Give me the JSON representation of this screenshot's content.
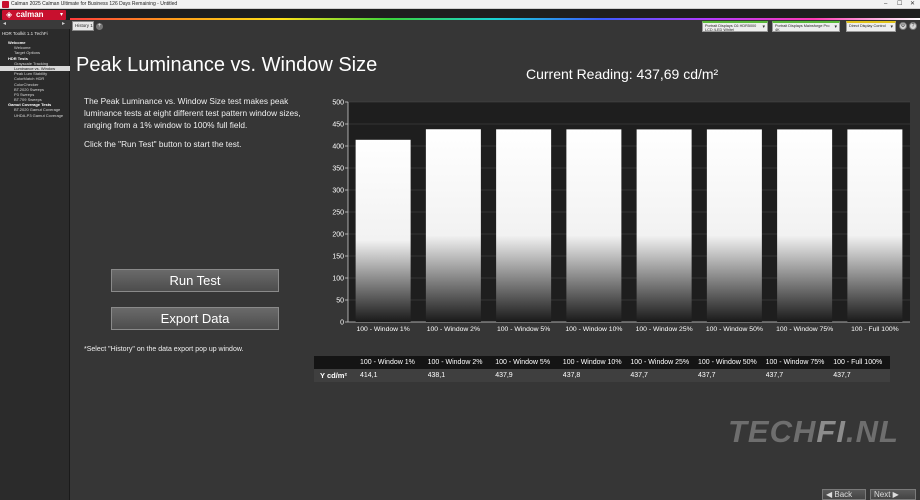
{
  "window": {
    "title": "Calman 2025 Calman Ultimate for Business 126 Days Remaining - Untitled",
    "controls": [
      "–",
      "☐",
      "✕"
    ]
  },
  "app": {
    "logo": "calman"
  },
  "sidebar": {
    "workspace": "HDR Toolkit 1.1 TechFi",
    "items": [
      {
        "label": "Welcome",
        "level": "h"
      },
      {
        "label": "Welcome",
        "level": "i"
      },
      {
        "label": "Target Options",
        "level": "i"
      },
      {
        "label": "HDR Tests",
        "level": "h"
      },
      {
        "label": "Grayscale Tracking",
        "level": "i"
      },
      {
        "label": "Luminance vs. Window",
        "level": "i",
        "selected": true
      },
      {
        "label": "Peak Lum Stability",
        "level": "i"
      },
      {
        "label": "ColorMatch HDR",
        "level": "i"
      },
      {
        "label": "ColorChecker",
        "level": "i"
      },
      {
        "label": "BT.2020 Sweeps",
        "level": "i"
      },
      {
        "label": "P3 Sweeps",
        "level": "i"
      },
      {
        "label": "BT.709 Sweeps",
        "level": "i"
      },
      {
        "label": "Gamut Coverage Tests",
        "level": "h"
      },
      {
        "label": "BT.2020 Gamut Coverage",
        "level": "i"
      },
      {
        "label": "UHDA-P3 Gamut Coverage",
        "level": "i"
      }
    ]
  },
  "tabs": [
    {
      "label": "History 1"
    }
  ],
  "toolbar": {
    "dropdown1": "Portrait Displays C6 HDR5000 LCD (LED White)",
    "dropdown2": "Portrait Displays Mainsforge Pro 4K",
    "dropdown3": "Direct Display Control"
  },
  "main": {
    "title": "Peak Luminance vs. Window Size",
    "current_reading": "Current Reading: 437,69 cd/m²",
    "description": "The Peak Luminance vs. Window Size test makes peak luminance tests at eight different test pattern window sizes, ranging from a 1% window to 100% full field.",
    "instruction": "Click the \"Run Test\" button to start the test.",
    "run_button": "Run Test",
    "export_button": "Export  Data",
    "footnote": "*Select \"History\" on the data export pop up window."
  },
  "chart_data": {
    "type": "bar",
    "categories": [
      "100 - Window  1%",
      "100 - Window  2%",
      "100 - Window  5%",
      "100 - Window 10%",
      "100 - Window 25%",
      "100 - Window 50%",
      "100 - Window 75%",
      "100 - Full  100%"
    ],
    "values": [
      414.1,
      438.1,
      437.9,
      437.8,
      437.7,
      437.7,
      437.7,
      437.7
    ],
    "ylim": [
      0,
      500
    ],
    "yticks": [
      0,
      50,
      100,
      150,
      200,
      250,
      300,
      350,
      400,
      450,
      500
    ],
    "grid": true,
    "colors": {
      "bar_top": "#ffffff",
      "bar_bottom": "#1a1a1a",
      "plot_bg": "#1e1e1e"
    }
  },
  "table": {
    "row_label": "Y cd/m²",
    "headers": [
      "100 - Window  1%",
      "100 - Window  2%",
      "100 - Window  5%",
      "100 - Window 10%",
      "100 - Window 25%",
      "100 - Window 50%",
      "100 - Window 75%",
      "100 - Full  100%"
    ],
    "values": [
      "414,1",
      "438,1",
      "437,9",
      "437,8",
      "437,7",
      "437,7",
      "437,7",
      "437,7"
    ]
  },
  "watermark": {
    "part1": "TECH",
    "part2": "FI",
    "part3": ".NL"
  },
  "footer": {
    "back": "◀ Back",
    "next": "Next ▶"
  }
}
